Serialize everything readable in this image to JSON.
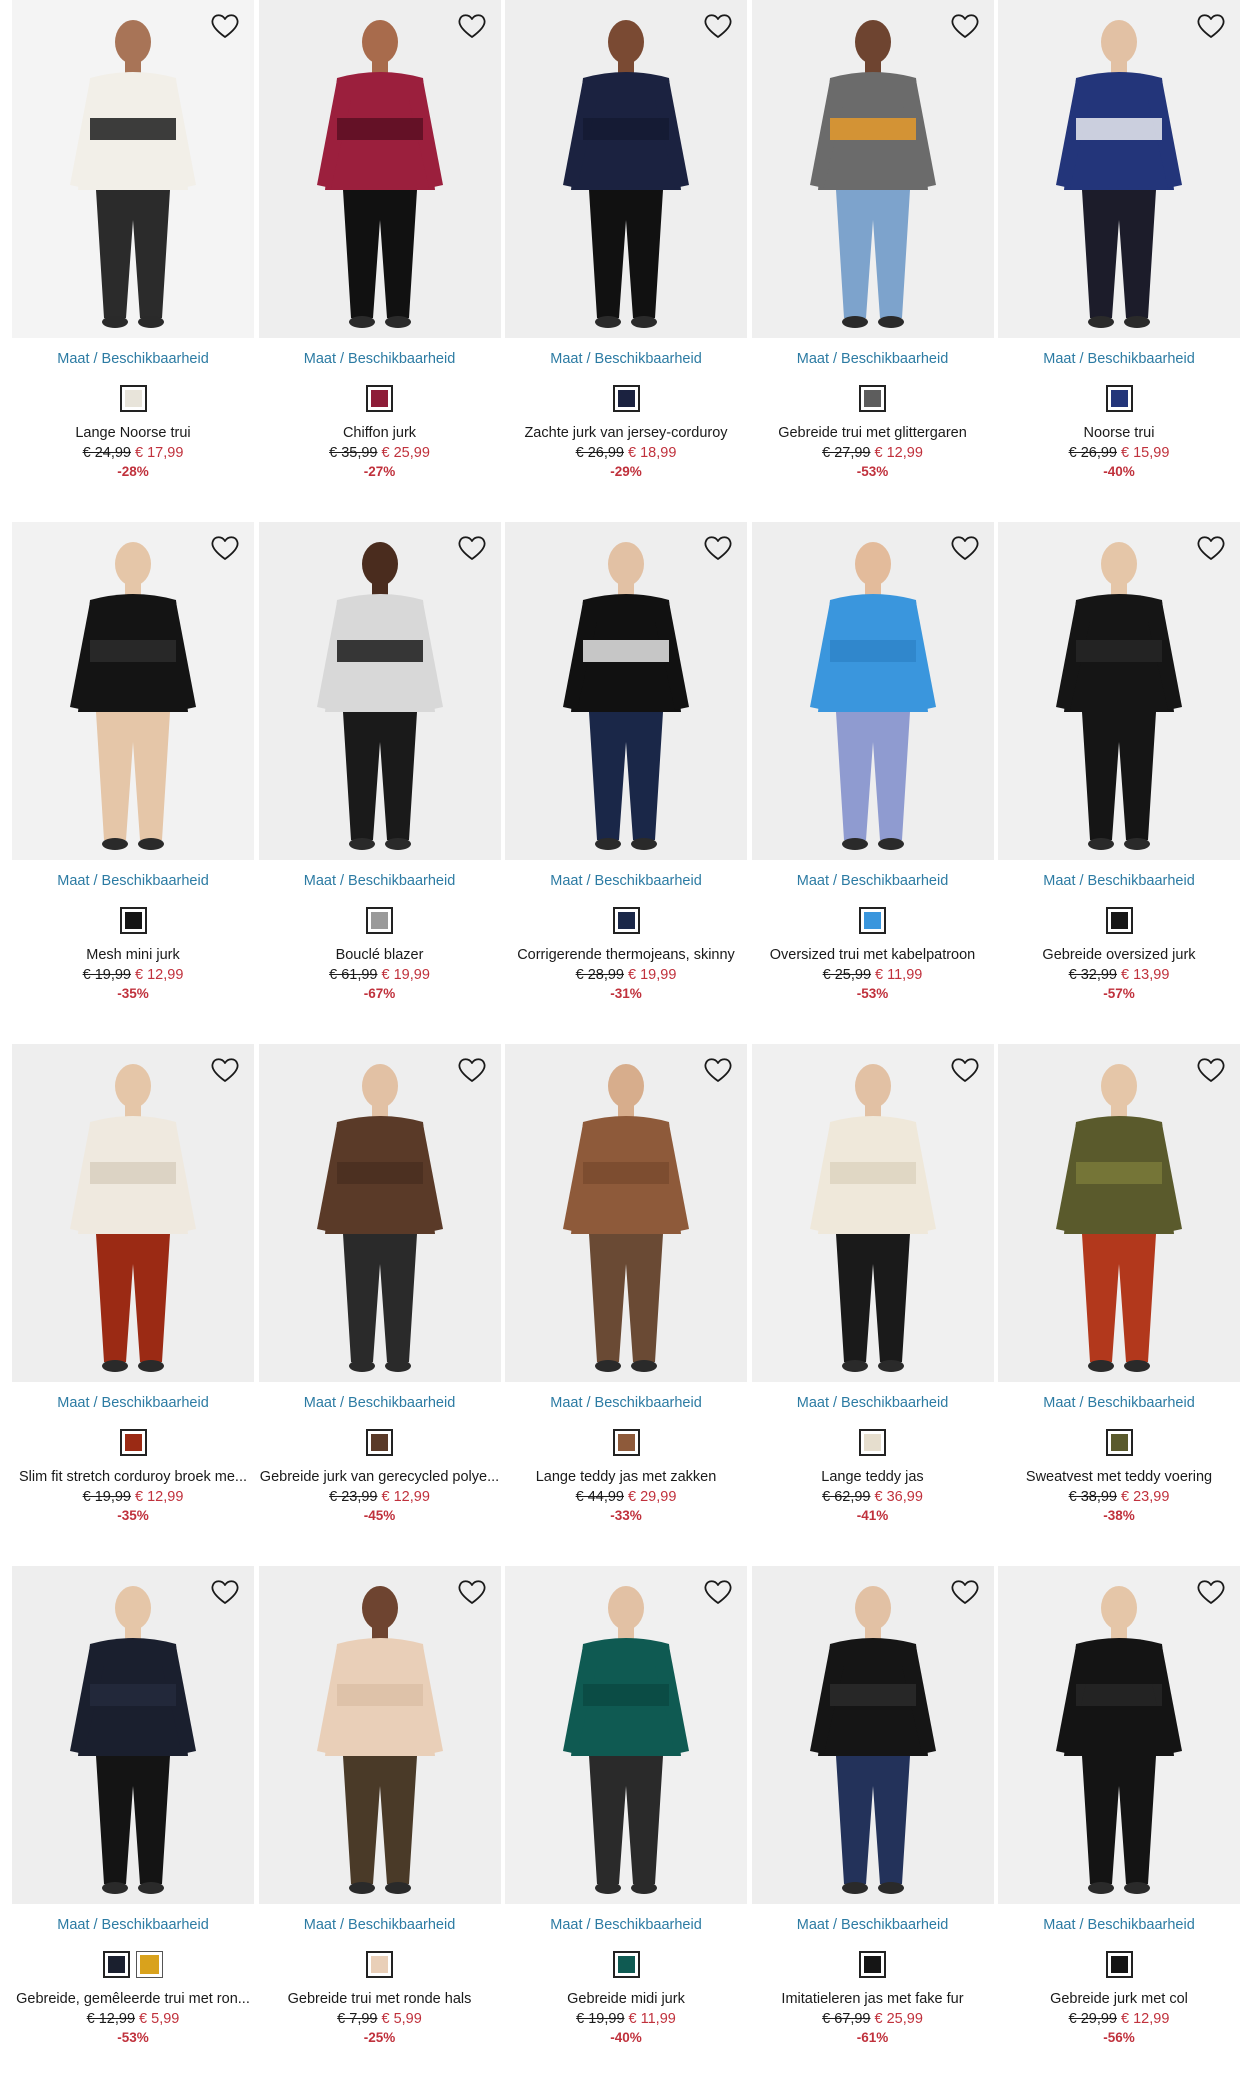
{
  "size_link_label": "Maat / Beschikbaarheid",
  "colors": {
    "link": "#2c7ba3",
    "sale": "#c0313c",
    "text": "#1a1a1a"
  },
  "products": [
    {
      "title": "Lange Noorse trui",
      "old_price": "€ 24,99",
      "new_price": "€ 17,99",
      "discount": "-28%",
      "garment": "#f2efe8",
      "pattern": "#1c1c1c",
      "skin": "#a87457",
      "legs": "#2b2b2b",
      "bg": "#f4f4f4",
      "swatches": [
        "#e8e4da"
      ]
    },
    {
      "title": "Chiffon jurk",
      "old_price": "€ 35,99",
      "new_price": "€ 25,99",
      "discount": "-27%",
      "garment": "#9b1f3d",
      "pattern": "#5b0f22",
      "skin": "#a86b4c",
      "legs": "#111111",
      "bg": "#eeeeee",
      "swatches": [
        "#8e1c38"
      ]
    },
    {
      "title": "Zachte jurk van jersey-corduroy",
      "old_price": "€ 26,99",
      "new_price": "€ 18,99",
      "discount": "-29%",
      "garment": "#1b2240",
      "pattern": "#141a33",
      "skin": "#7a4a33",
      "legs": "#111111",
      "bg": "#eeeeee",
      "swatches": [
        "#1b2240"
      ]
    },
    {
      "title": "Gebreide trui met glittergaren",
      "old_price": "€ 27,99",
      "new_price": "€ 12,99",
      "discount": "-53%",
      "garment": "#6b6b6b",
      "pattern": "#e59a2b",
      "skin": "#6e4430",
      "legs": "#7da3cc",
      "bg": "#efefef",
      "swatches": [
        "#5d5d5d"
      ]
    },
    {
      "title": "Noorse trui",
      "old_price": "€ 26,99",
      "new_price": "€ 15,99",
      "discount": "-40%",
      "garment": "#23357a",
      "pattern": "#e9eaf0",
      "skin": "#e2c1a4",
      "legs": "#1c1c2a",
      "bg": "#f0f0f0",
      "swatches": [
        "#23357a"
      ]
    },
    {
      "title": "Mesh mini jurk",
      "old_price": "€ 19,99",
      "new_price": "€ 12,99",
      "discount": "-35%",
      "garment": "#141414",
      "pattern": "#2b2b2b",
      "skin": "#e5c6a8",
      "legs": "#e5c6a8",
      "bg": "#f2f2f2",
      "swatches": [
        "#141414"
      ]
    },
    {
      "title": "Bouclé blazer",
      "old_price": "€ 61,99",
      "new_price": "€ 19,99",
      "discount": "-67%",
      "garment": "#d8d8d8",
      "pattern": "#1a1a1a",
      "skin": "#4a2c1e",
      "legs": "#1a1a1a",
      "bg": "#eeeeee",
      "swatches": [
        "#9a9a9a"
      ]
    },
    {
      "title": "Corrigerende thermojeans, skinny",
      "old_price": "€ 28,99",
      "new_price": "€ 19,99",
      "discount": "-31%",
      "garment": "#111111",
      "pattern": "#e6e6e6",
      "skin": "#e2c1a4",
      "legs": "#1a2748",
      "bg": "#eeeeee",
      "swatches": [
        "#1a2748"
      ]
    },
    {
      "title": "Oversized trui met kabelpatroon",
      "old_price": "€ 25,99",
      "new_price": "€ 11,99",
      "discount": "-53%",
      "garment": "#3a96dd",
      "pattern": "#2f85c9",
      "skin": "#e3bb9b",
      "legs": "#8f9bd0",
      "bg": "#eeeeee",
      "swatches": [
        "#3a96dd"
      ]
    },
    {
      "title": "Gebreide oversized jurk",
      "old_price": "€ 32,99",
      "new_price": "€ 13,99",
      "discount": "-57%",
      "garment": "#151515",
      "pattern": "#262626",
      "skin": "#e5c6a8",
      "legs": "#151515",
      "bg": "#f0f0f0",
      "swatches": [
        "#151515"
      ]
    },
    {
      "title": "Slim fit stretch corduroy broek me...",
      "old_price": "€ 19,99",
      "new_price": "€ 12,99",
      "discount": "-35%",
      "garment": "#efe9df",
      "pattern": "#d8cfbf",
      "skin": "#e5c6a8",
      "legs": "#9b2a14",
      "bg": "#eeeeee",
      "swatches": [
        "#9b2a14"
      ]
    },
    {
      "title": "Gebreide jurk van gerecycled polye...",
      "old_price": "€ 23,99",
      "new_price": "€ 12,99",
      "discount": "-45%",
      "garment": "#5a3a28",
      "pattern": "#4a2f20",
      "skin": "#e2c1a4",
      "legs": "#2a2a2a",
      "bg": "#eeeeee",
      "swatches": [
        "#5a3a28"
      ]
    },
    {
      "title": "Lange teddy jas met zakken",
      "old_price": "€ 44,99",
      "new_price": "€ 29,99",
      "discount": "-33%",
      "garment": "#8e5a3a",
      "pattern": "#7a4b2f",
      "skin": "#d7ad8c",
      "legs": "#6a4a34",
      "bg": "#eeeeee",
      "swatches": [
        "#8e5a3a"
      ]
    },
    {
      "title": "Lange teddy jas",
      "old_price": "€ 62,99",
      "new_price": "€ 36,99",
      "discount": "-41%",
      "garment": "#efe8da",
      "pattern": "#ddd3c0",
      "skin": "#e2c1a4",
      "legs": "#1a1a1a",
      "bg": "#f0f0f0",
      "swatches": [
        "#e6dece"
      ]
    },
    {
      "title": "Sweatvest met teddy voering",
      "old_price": "€ 38,99",
      "new_price": "€ 23,99",
      "discount": "-38%",
      "garment": "#5a5a2c",
      "pattern": "#7a7a3a",
      "skin": "#e5c6a8",
      "legs": "#b2381c",
      "bg": "#eeeeee",
      "swatches": [
        "#5a5a2c"
      ]
    },
    {
      "title": "Gebreide, gemêleerde trui met ron...",
      "old_price": "€ 12,99",
      "new_price": "€ 5,99",
      "discount": "-53%",
      "garment": "#1a1f2e",
      "pattern": "#242a3c",
      "skin": "#e5c6a8",
      "legs": "#141414",
      "bg": "#eeeeee",
      "swatches": [
        "#1a1f2e",
        "#d9a21c"
      ]
    },
    {
      "title": "Gebreide trui met ronde hals",
      "old_price": "€ 7,99",
      "new_price": "€ 5,99",
      "discount": "-25%",
      "garment": "#e9cfb8",
      "pattern": "#dcc0a6",
      "skin": "#6e4430",
      "legs": "#4a3a28",
      "bg": "#eeeeee",
      "swatches": [
        "#e9cfb8"
      ]
    },
    {
      "title": "Gebreide midi jurk",
      "old_price": "€ 19,99",
      "new_price": "€ 11,99",
      "discount": "-40%",
      "garment": "#0f5a52",
      "pattern": "#0b4a43",
      "skin": "#e2c1a4",
      "legs": "#2a2a2a",
      "bg": "#f0f0f0",
      "swatches": [
        "#0f5a52"
      ]
    },
    {
      "title": "Imitatieleren jas met fake fur",
      "old_price": "€ 67,99",
      "new_price": "€ 25,99",
      "discount": "-61%",
      "garment": "#151515",
      "pattern": "#2a2a2a",
      "skin": "#e2c1a4",
      "legs": "#23325a",
      "bg": "#eeeeee",
      "swatches": [
        "#151515"
      ]
    },
    {
      "title": "Gebreide jurk met col",
      "old_price": "€ 29,99",
      "new_price": "€ 12,99",
      "discount": "-56%",
      "garment": "#141414",
      "pattern": "#262626",
      "skin": "#e5c6a8",
      "legs": "#141414",
      "bg": "#f0f0f0",
      "swatches": [
        "#141414"
      ]
    }
  ]
}
